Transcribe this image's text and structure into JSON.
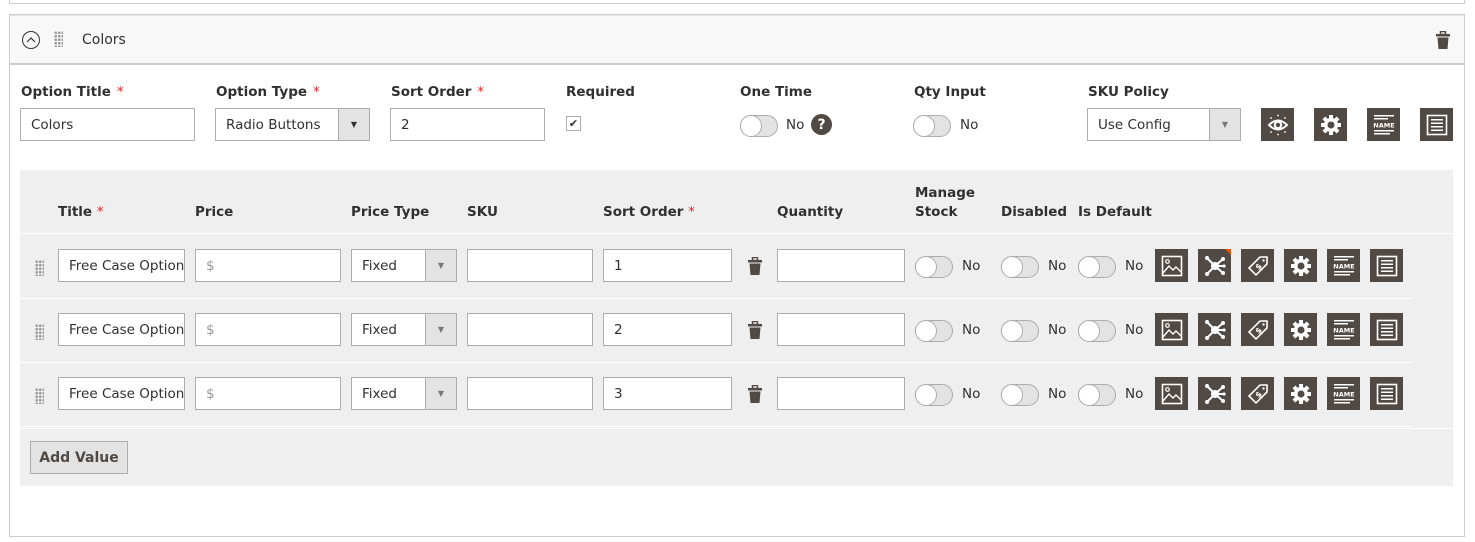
{
  "option": {
    "title": "Colors",
    "fields": {
      "option_title": {
        "label": "Option Title",
        "value": "Colors",
        "required": "*"
      },
      "option_type": {
        "label": "Option Type",
        "value": "Radio Buttons",
        "required": "*"
      },
      "sort_order": {
        "label": "Sort Order",
        "value": "2",
        "required": "*"
      },
      "required": {
        "label": "Required",
        "checked": true,
        "glyph": "✔"
      },
      "one_time": {
        "label": "One Time",
        "state": "No",
        "help": "?"
      },
      "qty_input": {
        "label": "Qty Input",
        "state": "No"
      },
      "sku_policy": {
        "label": "SKU Policy",
        "value": "Use Config"
      }
    },
    "toolbar_icons": [
      "visibility-icon",
      "settings-icon",
      "name-template-icon",
      "description-icon"
    ]
  },
  "values_table": {
    "headers": {
      "title": "Title",
      "required_mark": "*",
      "price": "Price",
      "price_type": "Price Type",
      "sku": "SKU",
      "sort_order": "Sort Order",
      "quantity": "Quantity",
      "manage_stock_1": "Manage",
      "manage_stock_2": "Stock",
      "disabled": "Disabled",
      "is_default": "Is Default"
    },
    "rows": [
      {
        "title": "Free Case Option",
        "price_placeholder": "$",
        "price_type": "Fixed",
        "sku": "",
        "sort_order": "1",
        "quantity": "",
        "manage_stock": "No",
        "disabled": "No",
        "is_default": "No",
        "flagged": true
      },
      {
        "title": "Free Case Option",
        "price_placeholder": "$",
        "price_type": "Fixed",
        "sku": "",
        "sort_order": "2",
        "quantity": "",
        "manage_stock": "No",
        "disabled": "No",
        "is_default": "No",
        "flagged": false
      },
      {
        "title": "Free Case Option",
        "price_placeholder": "$",
        "price_type": "Fixed",
        "sku": "",
        "sort_order": "3",
        "quantity": "",
        "manage_stock": "No",
        "disabled": "No",
        "is_default": "No",
        "flagged": false
      }
    ],
    "row_icons": [
      "image-icon",
      "dependency-icon",
      "price-tag-icon",
      "settings-icon",
      "name-template-icon",
      "description-icon"
    ],
    "add_value_label": "Add Value"
  },
  "colors": {
    "accent": "#514943",
    "required": "#e22626",
    "flag": "#eb5202"
  }
}
